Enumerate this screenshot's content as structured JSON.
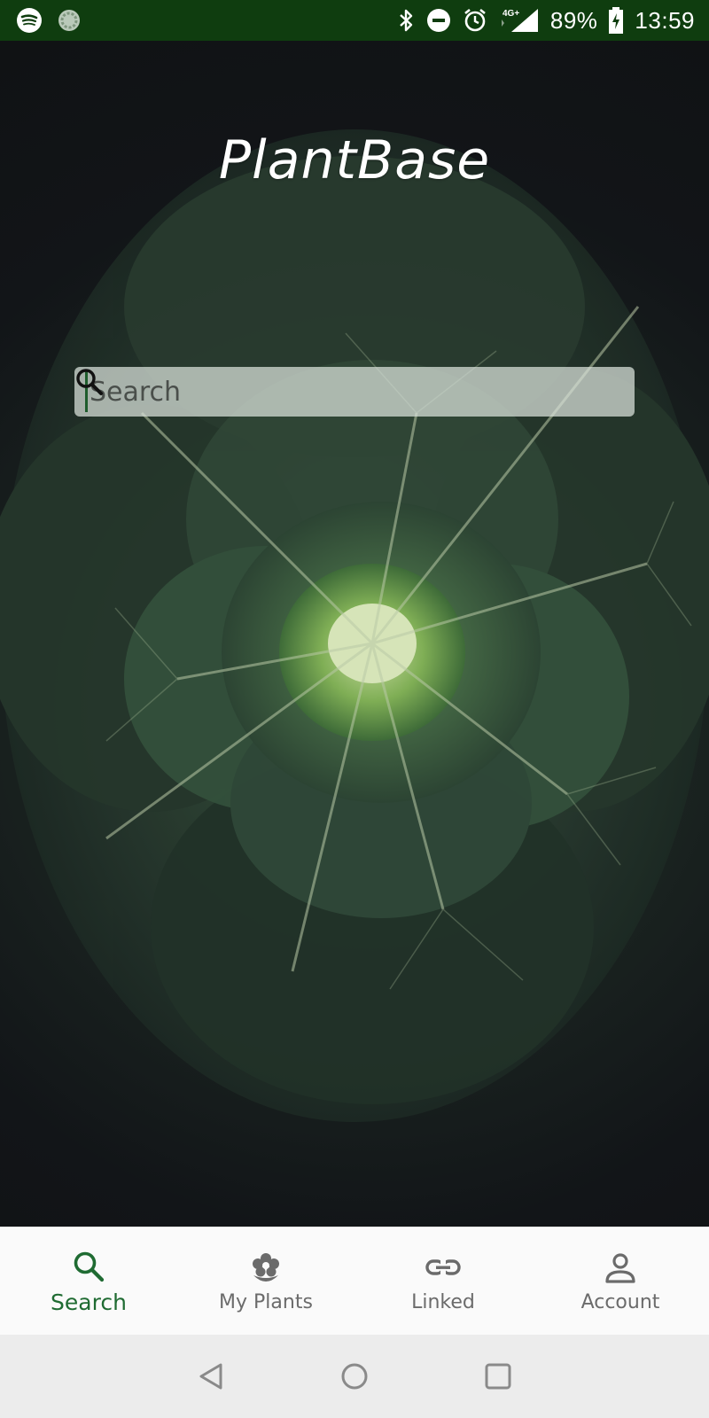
{
  "status_bar": {
    "left_icons": [
      "spotify-icon",
      "loading-icon"
    ],
    "right_icons": [
      "bluetooth-icon",
      "do-not-disturb-icon",
      "alarm-icon",
      "signal-icon",
      "battery-charging-icon"
    ],
    "network": "4G+",
    "battery": "89%",
    "time": "13:59",
    "bar_color": "#0f3d0f"
  },
  "app": {
    "title": "PlantBase"
  },
  "search": {
    "placeholder": "Search",
    "value": "",
    "button_icon": "search-icon",
    "cursor_color": "#1e5c2c"
  },
  "bottom_nav": {
    "active_color": "#1f6b32",
    "inactive_color": "#6b6b6b",
    "items": [
      {
        "label": "Search",
        "icon": "search-icon",
        "active": true
      },
      {
        "label": "My Plants",
        "icon": "flower-icon",
        "active": false
      },
      {
        "label": "Linked",
        "icon": "link-icon",
        "active": false
      },
      {
        "label": "Account",
        "icon": "person-icon",
        "active": false
      }
    ]
  },
  "system_nav": {
    "buttons": [
      "back-icon",
      "home-icon",
      "recents-icon"
    ]
  }
}
